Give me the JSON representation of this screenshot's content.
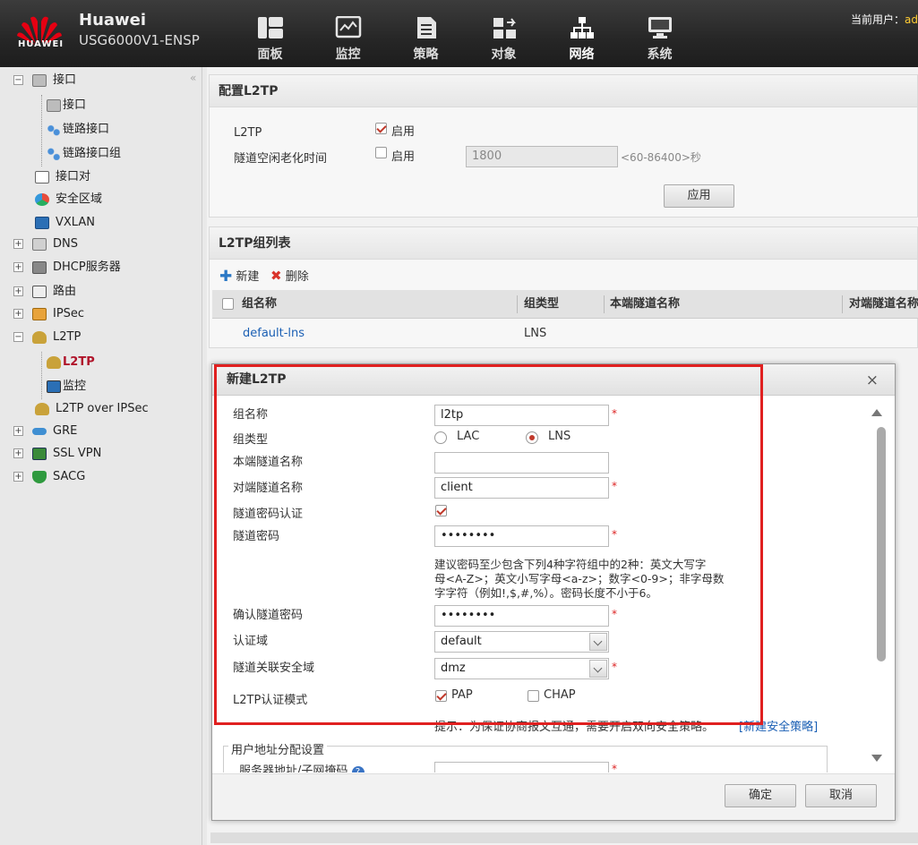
{
  "header": {
    "brand": "Huawei",
    "logo_text": "HUAWEI",
    "model": "USG6000V1-ENSP",
    "user_label": "当前用户：",
    "user_name": "ad",
    "nav": [
      {
        "label": "面板",
        "icon": "dashboard-icon"
      },
      {
        "label": "监控",
        "icon": "monitor-icon"
      },
      {
        "label": "策略",
        "icon": "policy-icon"
      },
      {
        "label": "对象",
        "icon": "object-icon"
      },
      {
        "label": "网络",
        "icon": "network-icon",
        "active": true
      },
      {
        "label": "系统",
        "icon": "system-icon"
      }
    ]
  },
  "sidebar": {
    "items": [
      {
        "label": "接口",
        "toggle": "−"
      },
      {
        "label": "接口"
      },
      {
        "label": "链路接口"
      },
      {
        "label": "链路接口组"
      },
      {
        "label": "接口对"
      },
      {
        "label": "安全区域"
      },
      {
        "label": "VXLAN"
      },
      {
        "label": "DNS",
        "toggle": "+"
      },
      {
        "label": "DHCP服务器",
        "toggle": "+"
      },
      {
        "label": "路由",
        "toggle": "+"
      },
      {
        "label": "IPSec",
        "toggle": "+"
      },
      {
        "label": "L2TP",
        "toggle": "−"
      },
      {
        "label": "L2TP",
        "selected": true
      },
      {
        "label": "监控"
      },
      {
        "label": "L2TP over IPSec"
      },
      {
        "label": "GRE",
        "toggle": "+"
      },
      {
        "label": "SSL VPN",
        "toggle": "+"
      },
      {
        "label": "SACG",
        "toggle": "+"
      }
    ]
  },
  "config_panel": {
    "title": "配置L2TP",
    "l2tp_label": "L2TP",
    "l2tp_enable": "启用",
    "idle_label": "隧道空闲老化时间",
    "idle_enable": "启用",
    "idle_value": "1800",
    "idle_range": "<60-86400>秒",
    "apply": "应用"
  },
  "group_panel": {
    "title": "L2TP组列表",
    "new": "新建",
    "delete": "删除",
    "columns": [
      "组名称",
      "组类型",
      "本端隧道名称",
      "对端隧道名称"
    ],
    "rows": [
      {
        "name": "default-lns",
        "type": "LNS"
      }
    ]
  },
  "dialog": {
    "title": "新建L2TP",
    "close": "×",
    "group_name_label": "组名称",
    "group_name_value": "l2tp",
    "group_type_label": "组类型",
    "type_lac": "LAC",
    "type_lns": "LNS",
    "local_tunnel_label": "本端隧道名称",
    "local_tunnel_value": "",
    "peer_tunnel_label": "对端隧道名称",
    "peer_tunnel_value": "client",
    "auth_label": "隧道密码认证",
    "password_label": "隧道密码",
    "password_value": "••••••••",
    "password_hint_1": "建议密码至少包含下列4种字符组中的2种：英文大写字",
    "password_hint_2": "母<A-Z>；英文小写字母<a-z>；数字<0-9>；非字母数",
    "password_hint_3": "字字符（例如!,$,#,%）。密码长度不小于6。",
    "confirm_label": "确认隧道密码",
    "confirm_value": "••••••••",
    "domain_label": "认证域",
    "domain_value": "default",
    "zone_label": "隧道关联安全域",
    "zone_value": "dmz",
    "mode_label": "L2TP认证模式",
    "mode_pap": "PAP",
    "mode_chap": "CHAP",
    "policy_hint": "提示：为保证协商报文互通，需要开启双向安全策略。",
    "policy_link": "[新建安全策略]",
    "addr_section": "用户地址分配设置",
    "server_addr_label": "服务器地址/子网掩码",
    "req_mark": "*",
    "ok": "确定",
    "cancel": "取消"
  }
}
